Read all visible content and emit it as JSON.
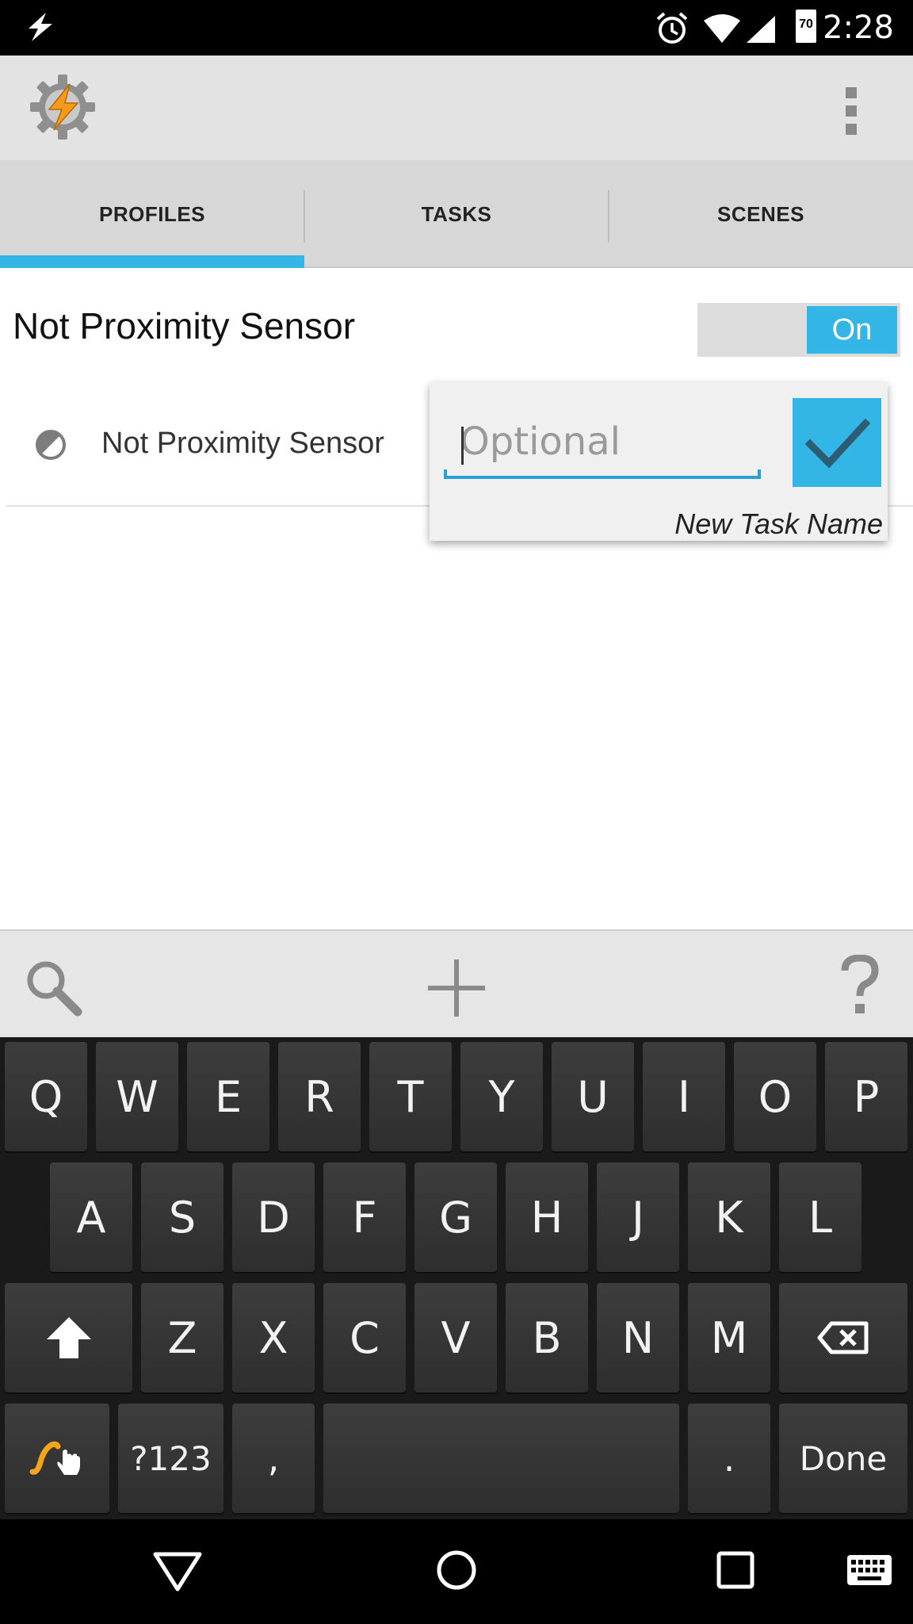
{
  "status_bar": {
    "time": "2:28",
    "battery_level": "70",
    "icons": [
      "tasker-bolt-icon",
      "alarm-icon",
      "wifi-icon",
      "cell-signal-icon",
      "battery-icon"
    ]
  },
  "app_bar": {
    "logo_icon": "tasker-gear-icon",
    "overflow_icon": "overflow-menu-icon"
  },
  "tabs": [
    {
      "label": "PROFILES",
      "active": true
    },
    {
      "label": "TASKS",
      "active": false
    },
    {
      "label": "SCENES",
      "active": false
    }
  ],
  "profile": {
    "title": "Not Proximity Sensor",
    "toggle_label": "On",
    "toggle_on": true,
    "context": {
      "label": "Not Proximity Sensor",
      "icon": "proximity-sensor-icon"
    }
  },
  "popup": {
    "input_placeholder": "Optional",
    "input_value": "",
    "caption": "New Task Name",
    "confirm_icon": "checkmark-icon"
  },
  "toolbar": {
    "search_icon": "search-icon",
    "add_icon": "plus-icon",
    "help_icon": "help-icon"
  },
  "keyboard": {
    "row1": [
      "Q",
      "W",
      "E",
      "R",
      "T",
      "Y",
      "U",
      "I",
      "O",
      "P"
    ],
    "row2": [
      "A",
      "S",
      "D",
      "F",
      "G",
      "H",
      "J",
      "K",
      "L"
    ],
    "row3": [
      "Z",
      "X",
      "C",
      "V",
      "B",
      "N",
      "M"
    ],
    "row4": {
      "symbols": "?123",
      "comma": ",",
      "period": ".",
      "done": "Done"
    }
  },
  "colors": {
    "accent": "#33b5e5",
    "input_line": "#2a9fd6",
    "keyboard_bg": "#1a1a1a",
    "key_bg": "#363636"
  }
}
